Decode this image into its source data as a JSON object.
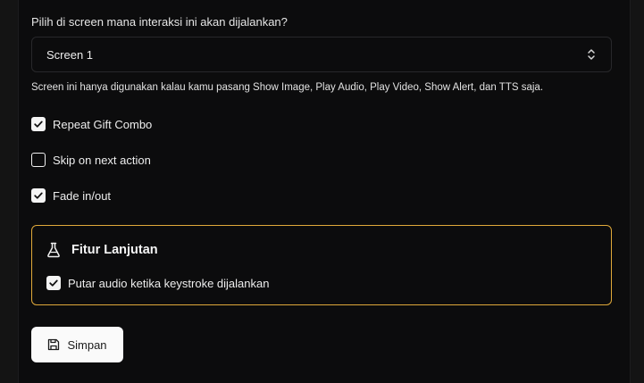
{
  "form": {
    "screen_question": "Pilih di screen mana interaksi ini akan dijalankan?",
    "screen_select": {
      "value": "Screen 1",
      "icon": "chevrons-up-down-icon"
    },
    "screen_hint": "Screen ini hanya digunakan kalau kamu pasang Show Image, Play Audio, Play Video, Show Alert, dan TTS saja.",
    "options": [
      {
        "label": "Repeat Gift Combo",
        "checked": true
      },
      {
        "label": "Skip on next action",
        "checked": false
      },
      {
        "label": "Fade in/out",
        "checked": true
      }
    ]
  },
  "advanced": {
    "title": "Fitur Lanjutan",
    "icon": "flask-icon",
    "border_color": "#e0a93a",
    "option": {
      "label": "Putar audio ketika keystroke dijalankan",
      "checked": true
    }
  },
  "actions": {
    "save_label": "Simpan",
    "save_icon": "save-icon"
  }
}
